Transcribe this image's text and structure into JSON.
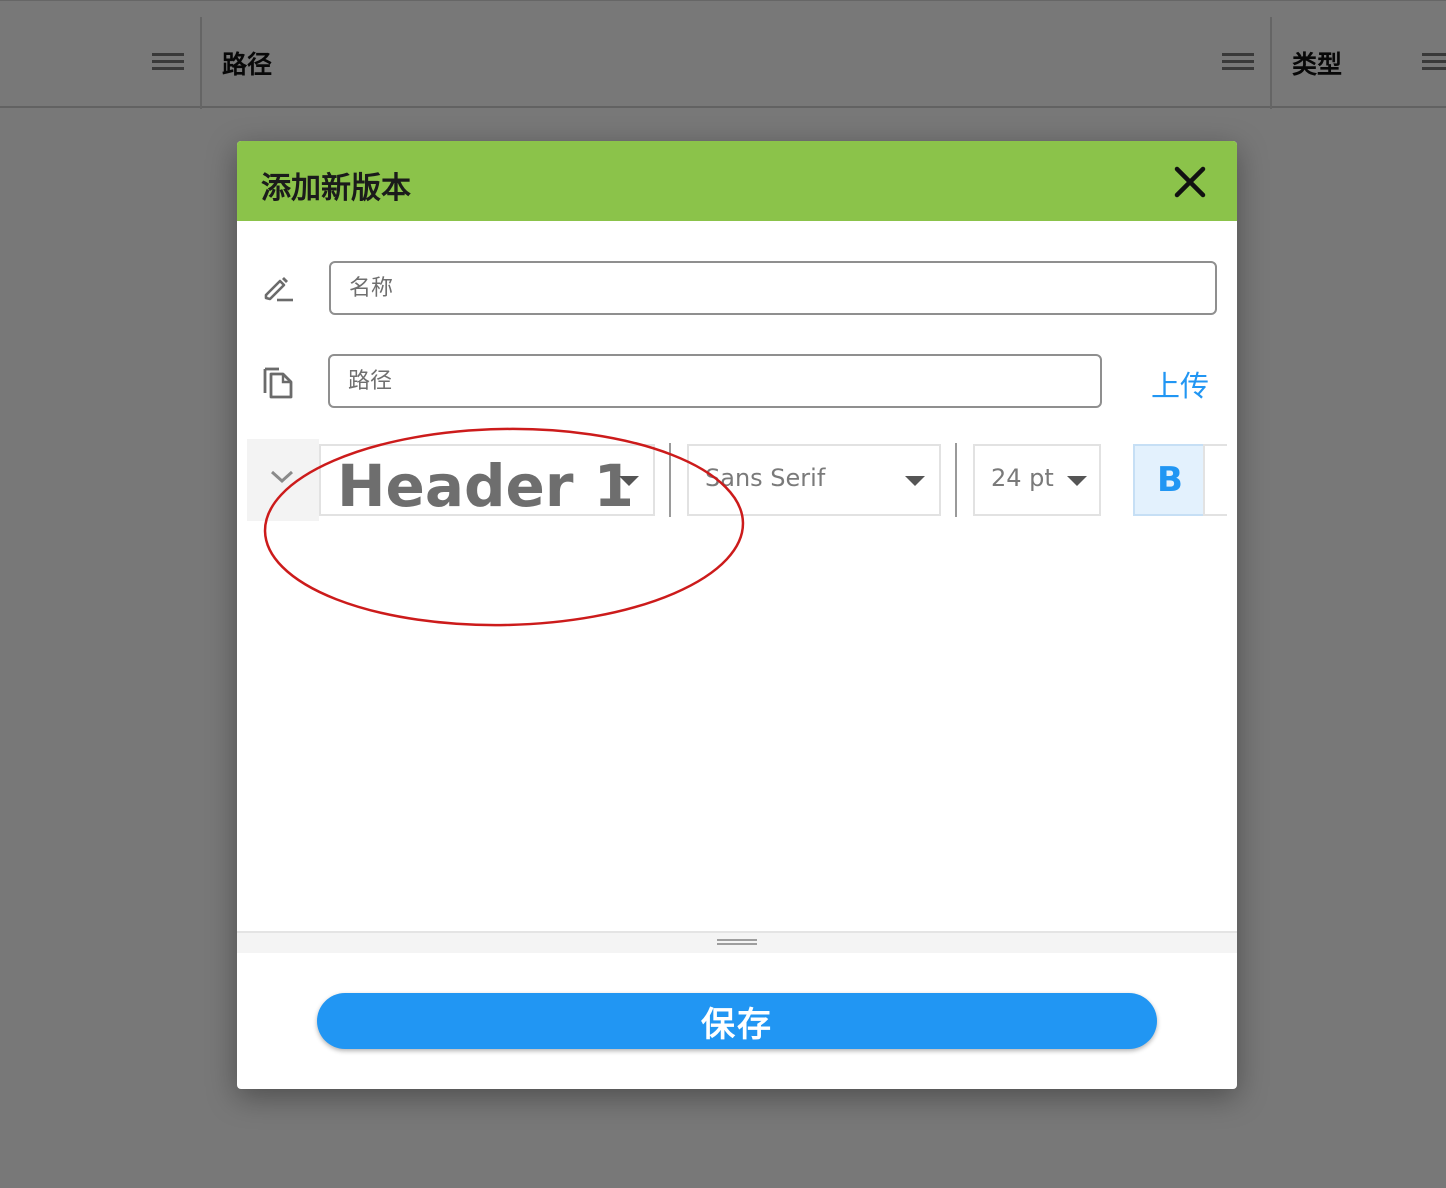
{
  "table_header": {
    "columns": [
      {
        "label": ""
      },
      {
        "label": "路径"
      },
      {
        "label": "类型"
      }
    ]
  },
  "dialog": {
    "title": "添加新版本",
    "name_field": {
      "placeholder": "名称",
      "value": ""
    },
    "path_field": {
      "placeholder": "路径",
      "value": ""
    },
    "upload_label": "上传",
    "toolbar": {
      "heading_value": "Header 1",
      "font_family_value": "Sans Serif",
      "font_size_value": "24 pt",
      "bold_label": "B"
    },
    "save_label": "保存"
  },
  "colors": {
    "header_green": "#8bc34a",
    "primary_blue": "#2196f3",
    "annotation_red": "#cc1b1b"
  },
  "icons": {
    "name_field": "edit-pencil-icon",
    "path_field": "copy-document-icon",
    "close": "close-icon",
    "toolbar_collapse": "chevron-down-icon"
  }
}
